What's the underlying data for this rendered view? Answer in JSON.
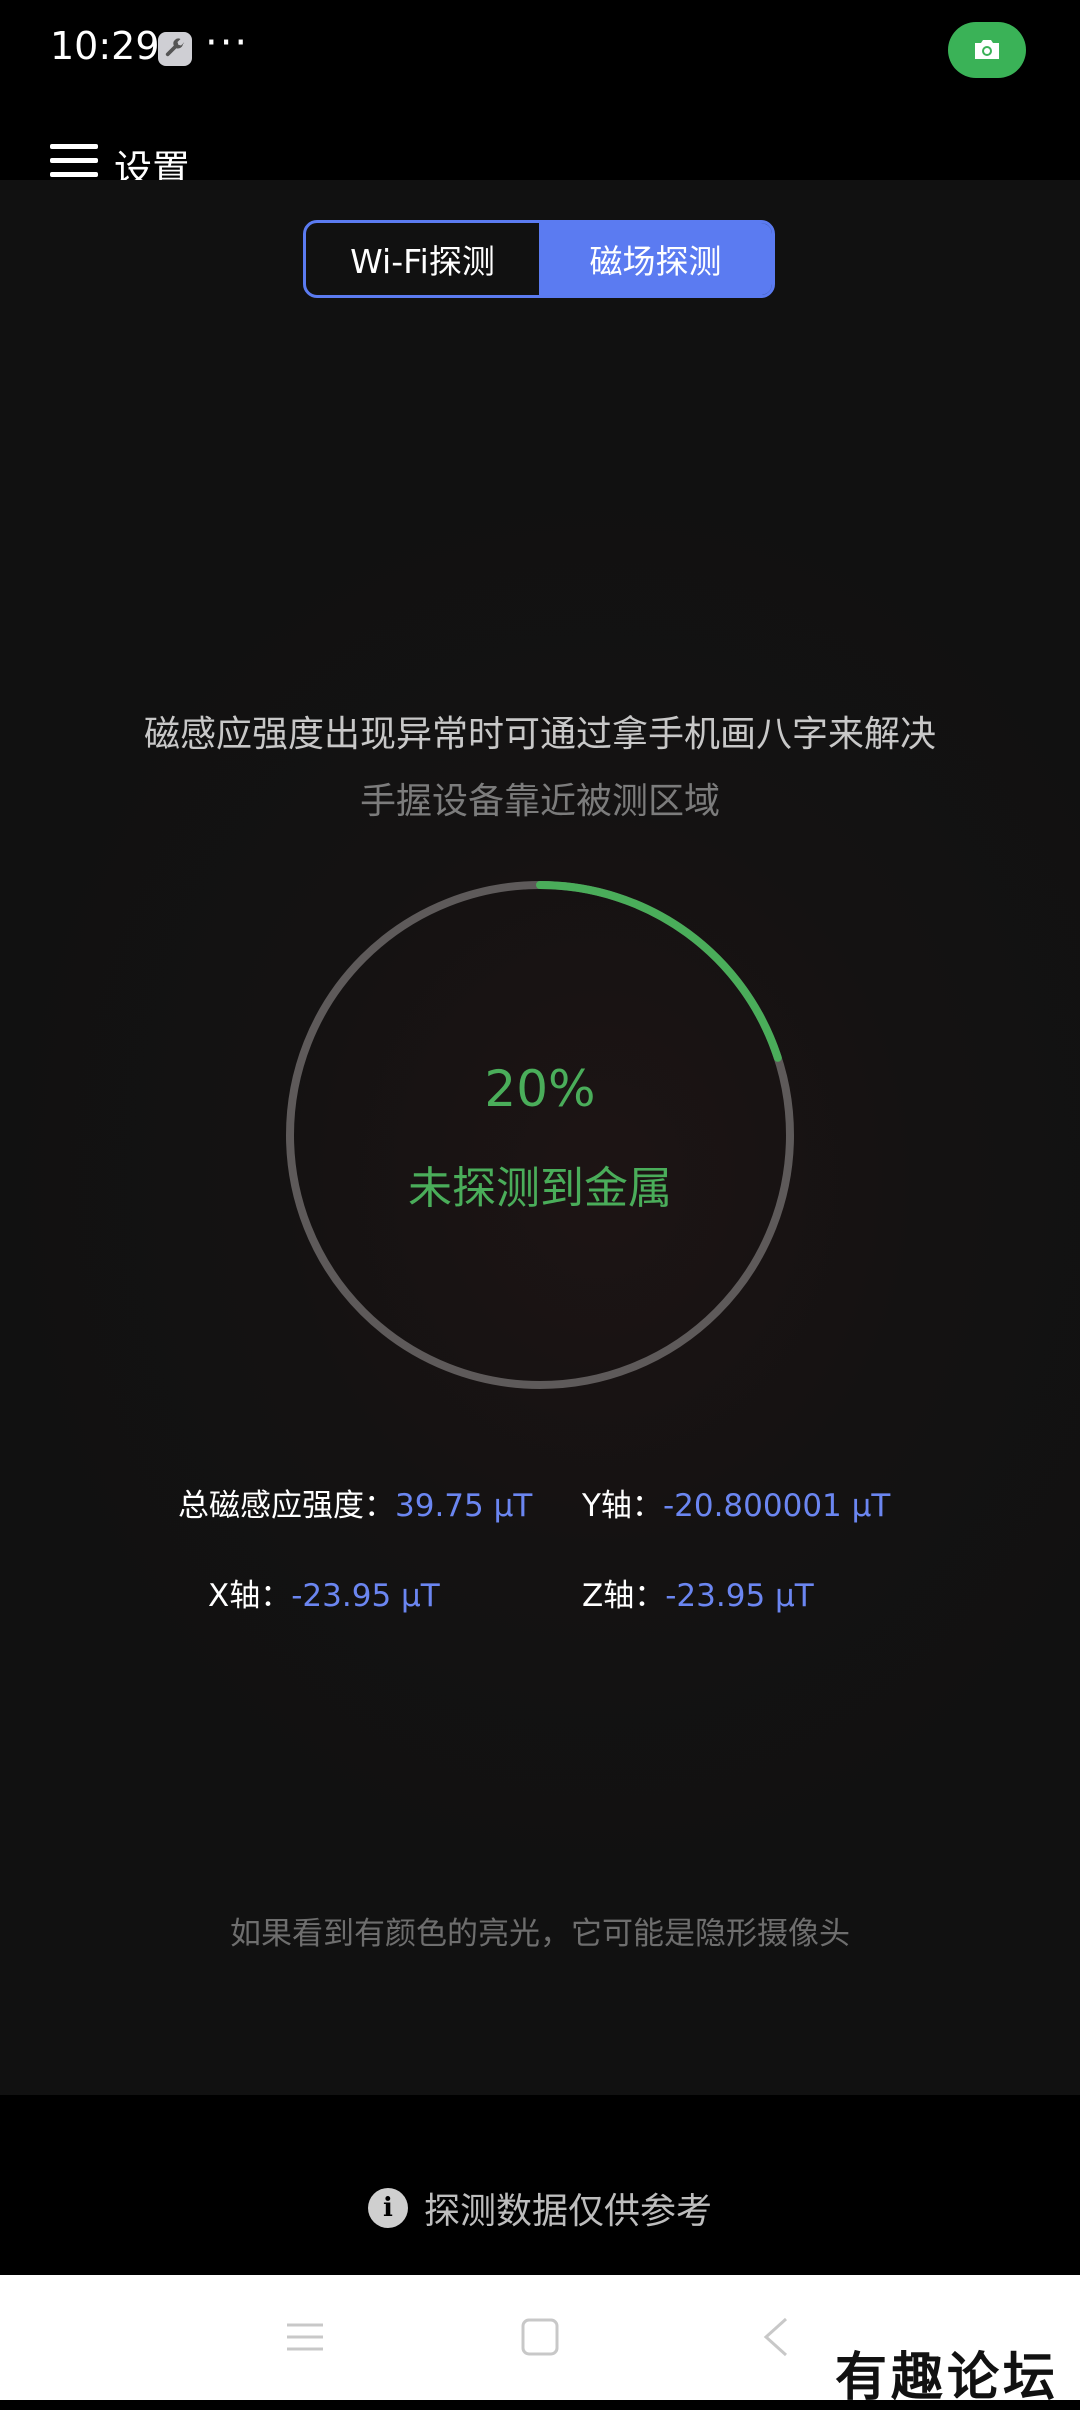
{
  "status_bar": {
    "time": "10:29",
    "overflow": "···",
    "wrench_icon": "wrench-icon",
    "camera_icon": "camera-icon",
    "camera_color": "#3ab257"
  },
  "app_bar": {
    "title": "设置",
    "menu_icon": "hamburger-menu-icon"
  },
  "toggle": {
    "wifi_label": "Wi-Fi探测",
    "magnetic_label": "磁场探测",
    "active": "magnetic",
    "accent": "#5b7bf1"
  },
  "hints": {
    "line1": "磁感应强度出现异常时可通过拿手机画八字来解决",
    "line2": "手握设备靠近被测区域"
  },
  "gauge": {
    "percent": "20%",
    "progress": 0.2,
    "status": "未探测到金属",
    "progress_color": "#4aad5a",
    "track_color": "#5e5a5a"
  },
  "readings": {
    "total": {
      "label": "总磁感应强度：",
      "value": "39.75 μT"
    },
    "y": {
      "label": "Y轴：",
      "value": "-20.800001 μT"
    },
    "x": {
      "label": "X轴：",
      "value": "-23.95 μT"
    },
    "z": {
      "label": "Z轴：",
      "value": "-23.95 μT"
    }
  },
  "bottom_tip": "如果看到有颜色的亮光，它可能是隐形摄像头",
  "disclaimer": {
    "text": "探测数据仅供参考",
    "icon": "info-icon"
  },
  "nav_bar": {
    "menu": "recent-apps-icon",
    "home": "home-icon",
    "back": "back-icon"
  },
  "watermark": "有趣论坛"
}
